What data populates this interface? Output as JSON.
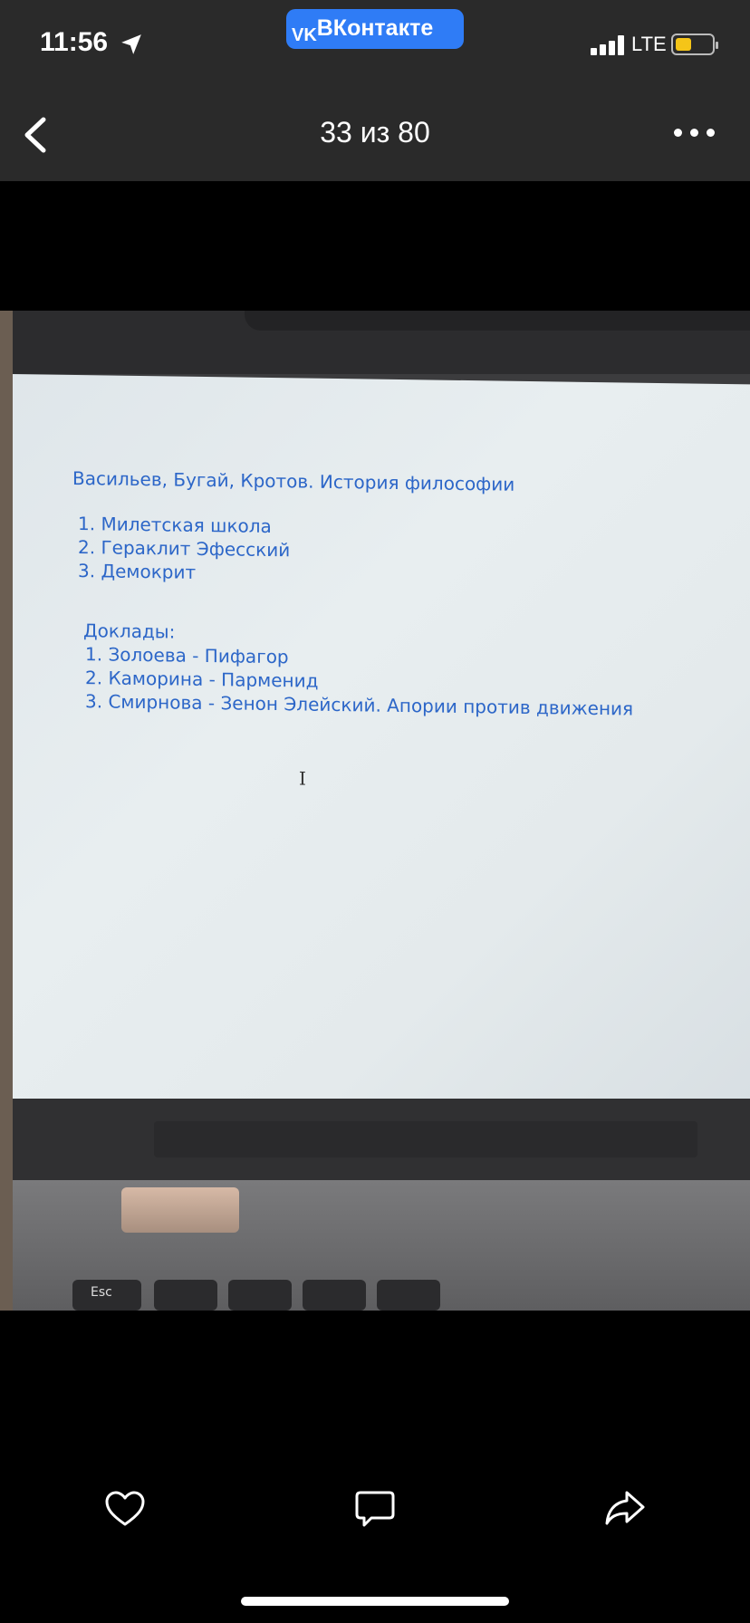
{
  "status_bar": {
    "time": "11:56",
    "app_pill": "ВКонтакте",
    "network": "LTE",
    "battery_level": 0.45
  },
  "nav": {
    "counter": "33 из 80"
  },
  "photo": {
    "screen_lines": [
      "Васильев, Бугай, Кротов. История философии",
      "1. Милетская школа",
      "2. Гераклит Эфесский",
      "3. Демокрит",
      "Доклады:",
      "1. Золоева - Пифагор",
      "2. Каморина - Парменид",
      "3. Смирнова - Зенон Элейский. Апории против движения"
    ],
    "keyboard_label": "Esc"
  },
  "toolbar": {
    "like_icon": "heart-icon",
    "comment_icon": "comment-icon",
    "share_icon": "share-icon"
  },
  "colors": {
    "accent": "#2f7cf6",
    "screen_text": "#2c66c8",
    "battery": "#f5c518"
  }
}
